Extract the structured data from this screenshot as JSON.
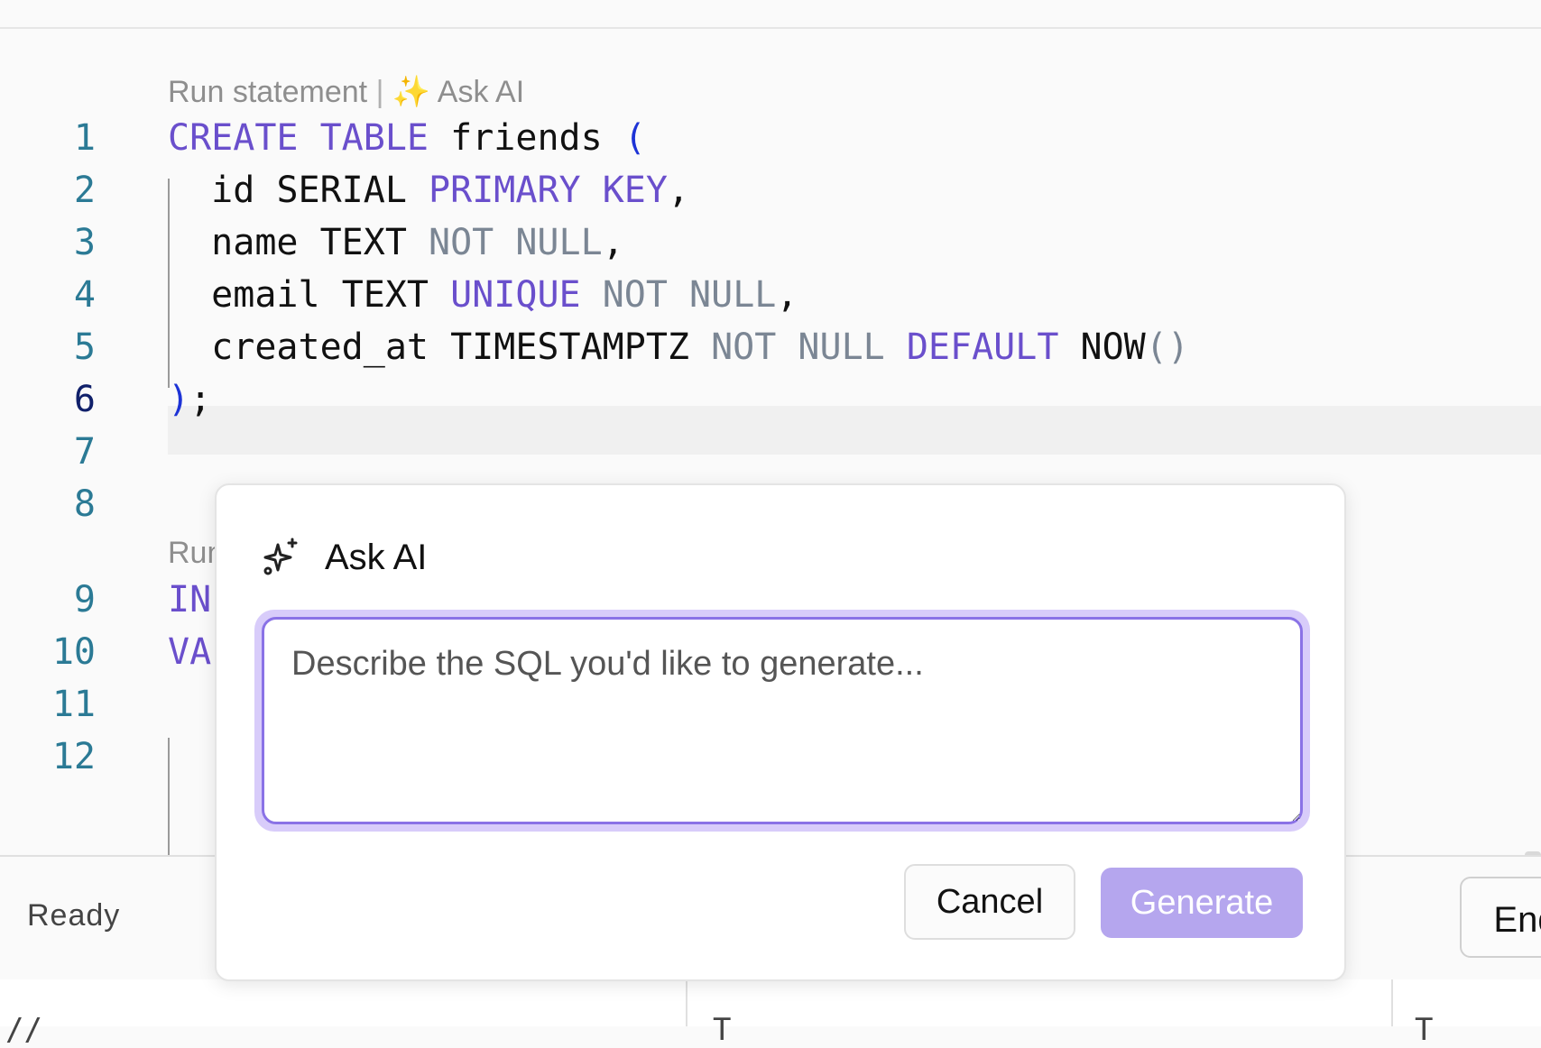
{
  "editor": {
    "codelens": {
      "block1": {
        "run": "Run statement",
        "sep": "|",
        "spark": "✨",
        "ask": "Ask AI"
      },
      "block2": {
        "run": "Run"
      }
    },
    "line_numbers": [
      "1",
      "2",
      "3",
      "4",
      "5",
      "6",
      "7",
      "8",
      "9",
      "10",
      "11",
      "12"
    ],
    "lines": {
      "l1": {
        "kw1": "CREATE",
        "kw2": "TABLE",
        "name": "friends",
        "paren": "("
      },
      "l2": {
        "col": "id",
        "type": "SERIAL",
        "kw": "PRIMARY KEY",
        "punct": ","
      },
      "l3": {
        "col": "name",
        "type": "TEXT",
        "nn": "NOT NULL",
        "punct": ","
      },
      "l4": {
        "col": "email",
        "type": "TEXT",
        "kw": "UNIQUE",
        "nn": "NOT NULL",
        "punct": ","
      },
      "l5": {
        "col": "created_at",
        "type": "TIMESTAMPTZ",
        "nn": "NOT NULL",
        "kw": "DEFAULT",
        "fn": "NOW",
        "parens": "()"
      },
      "l6": {
        "paren": ")",
        "semi": ";"
      },
      "l9": {
        "text": "IN"
      },
      "l10": {
        "text": "VA"
      }
    }
  },
  "status": {
    "text": "Ready",
    "end_button": "End"
  },
  "results": {
    "frag1": "//",
    "frag2": "T",
    "frag3": "T"
  },
  "ask_ai": {
    "title": "Ask AI",
    "icon": "sparkles-icon",
    "placeholder": "Describe the SQL you'd like to generate...",
    "value": "",
    "cancel_label": "Cancel",
    "generate_label": "Generate"
  },
  "colors": {
    "keyword": "#6a4fcc",
    "constraint": "#7b8694",
    "bracket": "#1d33d6",
    "line_number": "#2b7a95",
    "accent": "#8a72e6",
    "generate_disabled": "#b5a6ee"
  }
}
